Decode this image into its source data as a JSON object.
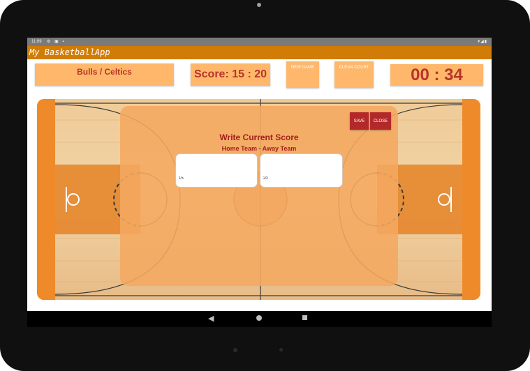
{
  "status_bar": {
    "time": "11:09",
    "left_icons": "⚙ ▣ ▪",
    "right_icons": "▾◢▮"
  },
  "app": {
    "title": "My BasketballApp",
    "accent": "#d07c06"
  },
  "header": {
    "teams": "Bulls / Celtics",
    "score": "Score: 15 : 20",
    "new_game_label": "NEW GAME",
    "clean_court_label": "CLEAN COURT",
    "timer": "00 : 34"
  },
  "dialog": {
    "title": "Write Current Score",
    "subtitle": "Home Team - Away Team",
    "save_label": "SAVE",
    "close_label": "CLOSE",
    "home_value": "15",
    "away_value": "20",
    "button_color": "#b3292a"
  },
  "nav": {
    "back_icon": "back-icon",
    "home_icon": "home-icon",
    "recent_icon": "recent-apps-icon"
  }
}
